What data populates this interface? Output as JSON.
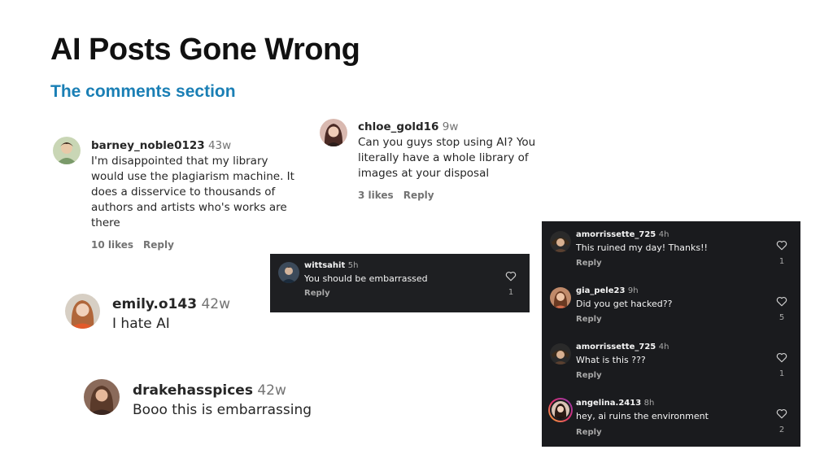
{
  "slide": {
    "title": "AI Posts Gone Wrong",
    "subtitle": "The comments section",
    "accent_color": "#1a7fb5"
  },
  "light_comments": [
    {
      "username": "barney_noble0123",
      "age": "43w",
      "lines": [
        "I'm disappointed that my library",
        "would use the plagiarism machine. It",
        "does a disservice to thousands of",
        "authors and artists who's works are",
        "there"
      ],
      "likes": "10 likes",
      "reply": "Reply"
    },
    {
      "username": "chloe_gold16",
      "age": "9w",
      "lines": [
        "Can you guys stop using AI? You",
        "literally have a whole library of",
        "images at your disposal"
      ],
      "likes": "3 likes",
      "reply": "Reply"
    },
    {
      "username": "emily.o143",
      "age": "42w",
      "text": "I hate AI"
    },
    {
      "username": "drakehasspices",
      "age": "42w",
      "text": "Booo this is embarrassing"
    }
  ],
  "dark_single": {
    "username": "wittsahit",
    "age": "5h",
    "text": "You should be embarrassed",
    "reply": "Reply",
    "likes": "1",
    "icon": "heart-outline-icon"
  },
  "dark_thread": [
    {
      "username": "amorrissette_725",
      "age": "4h",
      "text": "This ruined my day! Thanks!!",
      "reply": "Reply",
      "likes": "1"
    },
    {
      "username": "gia_pele23",
      "age": "9h",
      "text": "Did you get hacked??",
      "reply": "Reply",
      "likes": "5"
    },
    {
      "username": "amorrissette_725",
      "age": "4h",
      "text": "What is this ???",
      "reply": "Reply",
      "likes": "1"
    },
    {
      "username": "angelina.2413",
      "age": "8h",
      "text": "hey, ai ruins the environment",
      "reply": "Reply",
      "likes": "2"
    }
  ]
}
